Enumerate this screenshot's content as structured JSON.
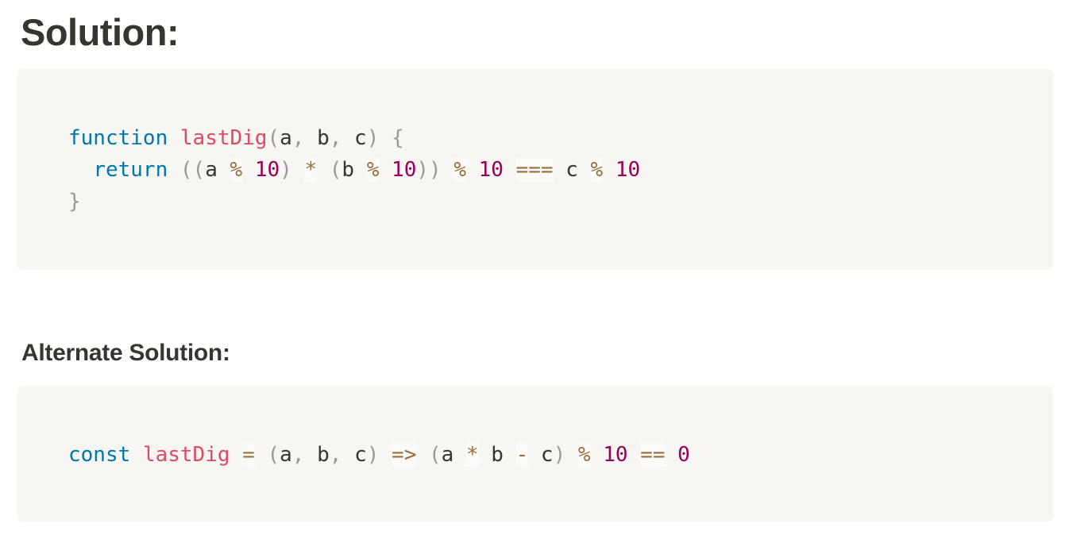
{
  "headings": {
    "solution": "Solution:",
    "alternate": "Alternate Solution:"
  },
  "code_blocks": [
    {
      "language": "javascript",
      "lines": [
        [
          {
            "t": "function",
            "c": "kw"
          },
          {
            "t": " ",
            "c": "var"
          },
          {
            "t": "lastDig",
            "c": "fn"
          },
          {
            "t": "(",
            "c": "pun"
          },
          {
            "t": "a",
            "c": "var"
          },
          {
            "t": ",",
            "c": "pun"
          },
          {
            "t": " b",
            "c": "var"
          },
          {
            "t": ",",
            "c": "pun"
          },
          {
            "t": " c",
            "c": "var"
          },
          {
            "t": ")",
            "c": "pun"
          },
          {
            "t": " ",
            "c": "var"
          },
          {
            "t": "{",
            "c": "pun"
          }
        ],
        [
          {
            "t": "  ",
            "c": "var"
          },
          {
            "t": "return",
            "c": "kw"
          },
          {
            "t": " ",
            "c": "var"
          },
          {
            "t": "((",
            "c": "pun"
          },
          {
            "t": "a ",
            "c": "var"
          },
          {
            "t": "%",
            "c": "op"
          },
          {
            "t": " ",
            "c": "var"
          },
          {
            "t": "10",
            "c": "num"
          },
          {
            "t": ")",
            "c": "pun"
          },
          {
            "t": " ",
            "c": "var"
          },
          {
            "t": "*",
            "c": "op"
          },
          {
            "t": " ",
            "c": "var"
          },
          {
            "t": "(",
            "c": "pun"
          },
          {
            "t": "b ",
            "c": "var"
          },
          {
            "t": "%",
            "c": "op"
          },
          {
            "t": " ",
            "c": "var"
          },
          {
            "t": "10",
            "c": "num"
          },
          {
            "t": "))",
            "c": "pun"
          },
          {
            "t": " ",
            "c": "var"
          },
          {
            "t": "%",
            "c": "op"
          },
          {
            "t": " ",
            "c": "var"
          },
          {
            "t": "10",
            "c": "num"
          },
          {
            "t": " ",
            "c": "var"
          },
          {
            "t": "===",
            "c": "op"
          },
          {
            "t": " c ",
            "c": "var"
          },
          {
            "t": "%",
            "c": "op"
          },
          {
            "t": " ",
            "c": "var"
          },
          {
            "t": "10",
            "c": "num"
          }
        ],
        [
          {
            "t": "}",
            "c": "pun"
          }
        ]
      ]
    },
    {
      "language": "javascript",
      "lines": [
        [
          {
            "t": "const",
            "c": "kw"
          },
          {
            "t": " ",
            "c": "var"
          },
          {
            "t": "lastDig",
            "c": "fn"
          },
          {
            "t": " ",
            "c": "var"
          },
          {
            "t": "=",
            "c": "op"
          },
          {
            "t": " ",
            "c": "var"
          },
          {
            "t": "(",
            "c": "pun"
          },
          {
            "t": "a",
            "c": "var"
          },
          {
            "t": ",",
            "c": "pun"
          },
          {
            "t": " b",
            "c": "var"
          },
          {
            "t": ",",
            "c": "pun"
          },
          {
            "t": " c",
            "c": "var"
          },
          {
            "t": ")",
            "c": "pun"
          },
          {
            "t": " ",
            "c": "var"
          },
          {
            "t": "=>",
            "c": "op"
          },
          {
            "t": " ",
            "c": "var"
          },
          {
            "t": "(",
            "c": "pun"
          },
          {
            "t": "a ",
            "c": "var"
          },
          {
            "t": "*",
            "c": "op"
          },
          {
            "t": " b ",
            "c": "var"
          },
          {
            "t": "-",
            "c": "op"
          },
          {
            "t": " c",
            "c": "var"
          },
          {
            "t": ")",
            "c": "pun"
          },
          {
            "t": " ",
            "c": "var"
          },
          {
            "t": "%",
            "c": "op"
          },
          {
            "t": " ",
            "c": "var"
          },
          {
            "t": "10",
            "c": "num"
          },
          {
            "t": " ",
            "c": "var"
          },
          {
            "t": "==",
            "c": "op"
          },
          {
            "t": " ",
            "c": "var"
          },
          {
            "t": "0",
            "c": "num"
          }
        ]
      ]
    }
  ]
}
